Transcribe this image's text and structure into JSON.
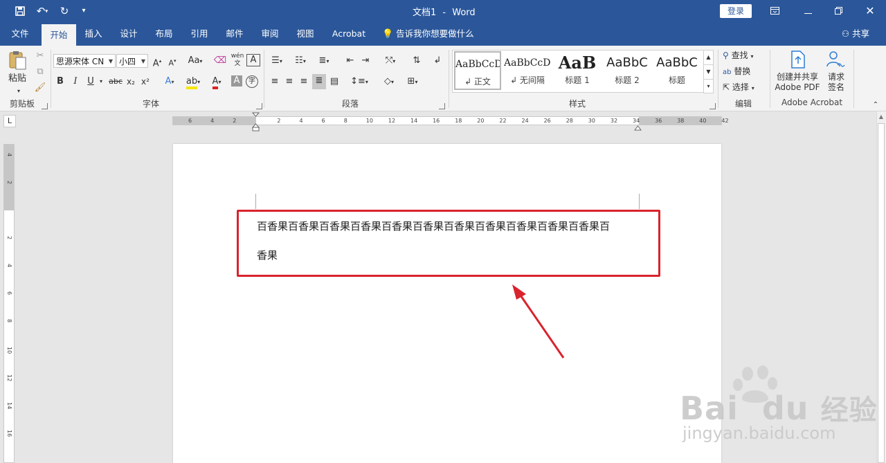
{
  "title_bar": {
    "doc_title": "文档1",
    "separator": "-",
    "app_name": "Word",
    "login_label": "登录",
    "quick_access": {
      "save_icon": "save-icon",
      "undo_icon": "undo-icon",
      "redo_icon": "redo-icon",
      "customize_icon": "customize-icon"
    }
  },
  "tabs": [
    {
      "label": "文件"
    },
    {
      "label": "开始"
    },
    {
      "label": "插入"
    },
    {
      "label": "设计"
    },
    {
      "label": "布局"
    },
    {
      "label": "引用"
    },
    {
      "label": "邮件"
    },
    {
      "label": "审阅"
    },
    {
      "label": "视图"
    },
    {
      "label": "Acrobat"
    }
  ],
  "tell_me": "告诉我你想要做什么",
  "share_label": "共享",
  "ribbon": {
    "clipboard": {
      "paste_label": "粘贴",
      "group_label": "剪贴板"
    },
    "font": {
      "font_name": "思源宋体 CN",
      "font_size": "小四",
      "change_case": "Aa",
      "phonetic": "wén",
      "bold": "B",
      "italic": "I",
      "underline": "U",
      "strike": "abc",
      "subscript": "x₂",
      "superscript": "x²",
      "group_label": "字体"
    },
    "paragraph": {
      "group_label": "段落"
    },
    "styles": {
      "group_label": "样式",
      "items": [
        {
          "sample": "AaBbCcDd",
          "name": "↲ 正文"
        },
        {
          "sample": "AaBbCcDd",
          "name": "↲ 无间隔"
        },
        {
          "sample": "AaB",
          "name": "标题 1"
        },
        {
          "sample": "AaBbC",
          "name": "标题 2"
        },
        {
          "sample": "AaBbC",
          "name": "标题"
        }
      ]
    },
    "editing": {
      "find": "查找",
      "replace": "替换",
      "select": "选择",
      "group_label": "编辑"
    },
    "acrobat": {
      "create_pdf_line1": "创建并共享",
      "create_pdf_line2": "Adobe PDF",
      "request_line1": "请求",
      "request_line2": "签名",
      "group_label": "Adobe Acrobat"
    }
  },
  "ruler": {
    "tab_selector": "L",
    "h_labels": [
      "6",
      "4",
      "2",
      "2",
      "4",
      "6",
      "8",
      "10",
      "12",
      "14",
      "16",
      "18",
      "20",
      "22",
      "24",
      "26",
      "28",
      "30",
      "32",
      "34",
      "36",
      "38",
      "40",
      "42"
    ],
    "v_labels": [
      "4",
      "2",
      "2",
      "4",
      "6",
      "8",
      "10",
      "12",
      "14",
      "16"
    ]
  },
  "document": {
    "line1": "百香果百香果百香果百香果百香果百香果百香果百香果百香果百香果百香果百",
    "line2": "香果"
  },
  "watermark": {
    "brand": "Bai",
    "brand2": "du",
    "suffix": "经验",
    "url": "jingyan.baidu.com"
  },
  "colors": {
    "accent": "#2b579a",
    "highlight": "#d9232d"
  }
}
